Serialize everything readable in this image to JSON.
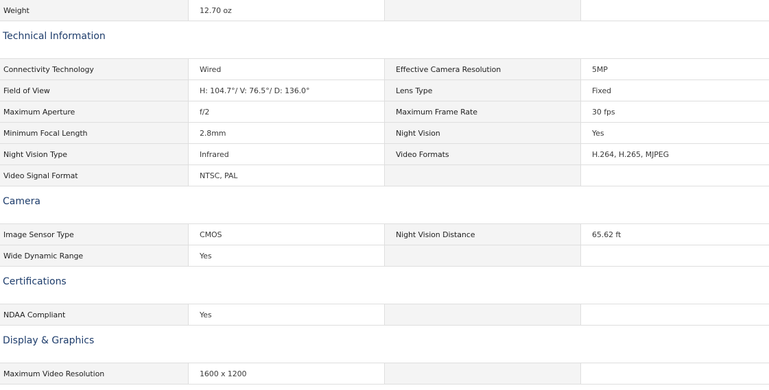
{
  "top_row": {
    "label": "Weight",
    "value": "12.70 oz"
  },
  "sections": [
    {
      "title": "Technical Information",
      "rows": [
        [
          "Connectivity Technology",
          "Wired",
          "Effective Camera Resolution",
          "5MP"
        ],
        [
          "Field of View",
          "H: 104.7°/ V: 76.5°/ D: 136.0°",
          "Lens Type",
          "Fixed"
        ],
        [
          "Maximum Aperture",
          "f/2",
          "Maximum Frame Rate",
          "30 fps"
        ],
        [
          "Minimum Focal Length",
          "2.8mm",
          "Night Vision",
          "Yes"
        ],
        [
          "Night Vision Type",
          "Infrared",
          "Video Formats",
          "H.264, H.265, MJPEG"
        ],
        [
          "Video Signal Format",
          "NTSC, PAL",
          "",
          ""
        ]
      ]
    },
    {
      "title": "Camera",
      "rows": [
        [
          "Image Sensor Type",
          "CMOS",
          "Night Vision Distance",
          "65.62 ft"
        ],
        [
          "Wide Dynamic Range",
          "Yes",
          "",
          ""
        ]
      ]
    },
    {
      "title": "Certifications",
      "rows": [
        [
          "NDAA Compliant",
          "Yes",
          "",
          ""
        ]
      ]
    },
    {
      "title": "Display & Graphics",
      "rows": [
        [
          "Maximum Video Resolution",
          "1600 x 1200",
          "",
          ""
        ]
      ]
    }
  ]
}
